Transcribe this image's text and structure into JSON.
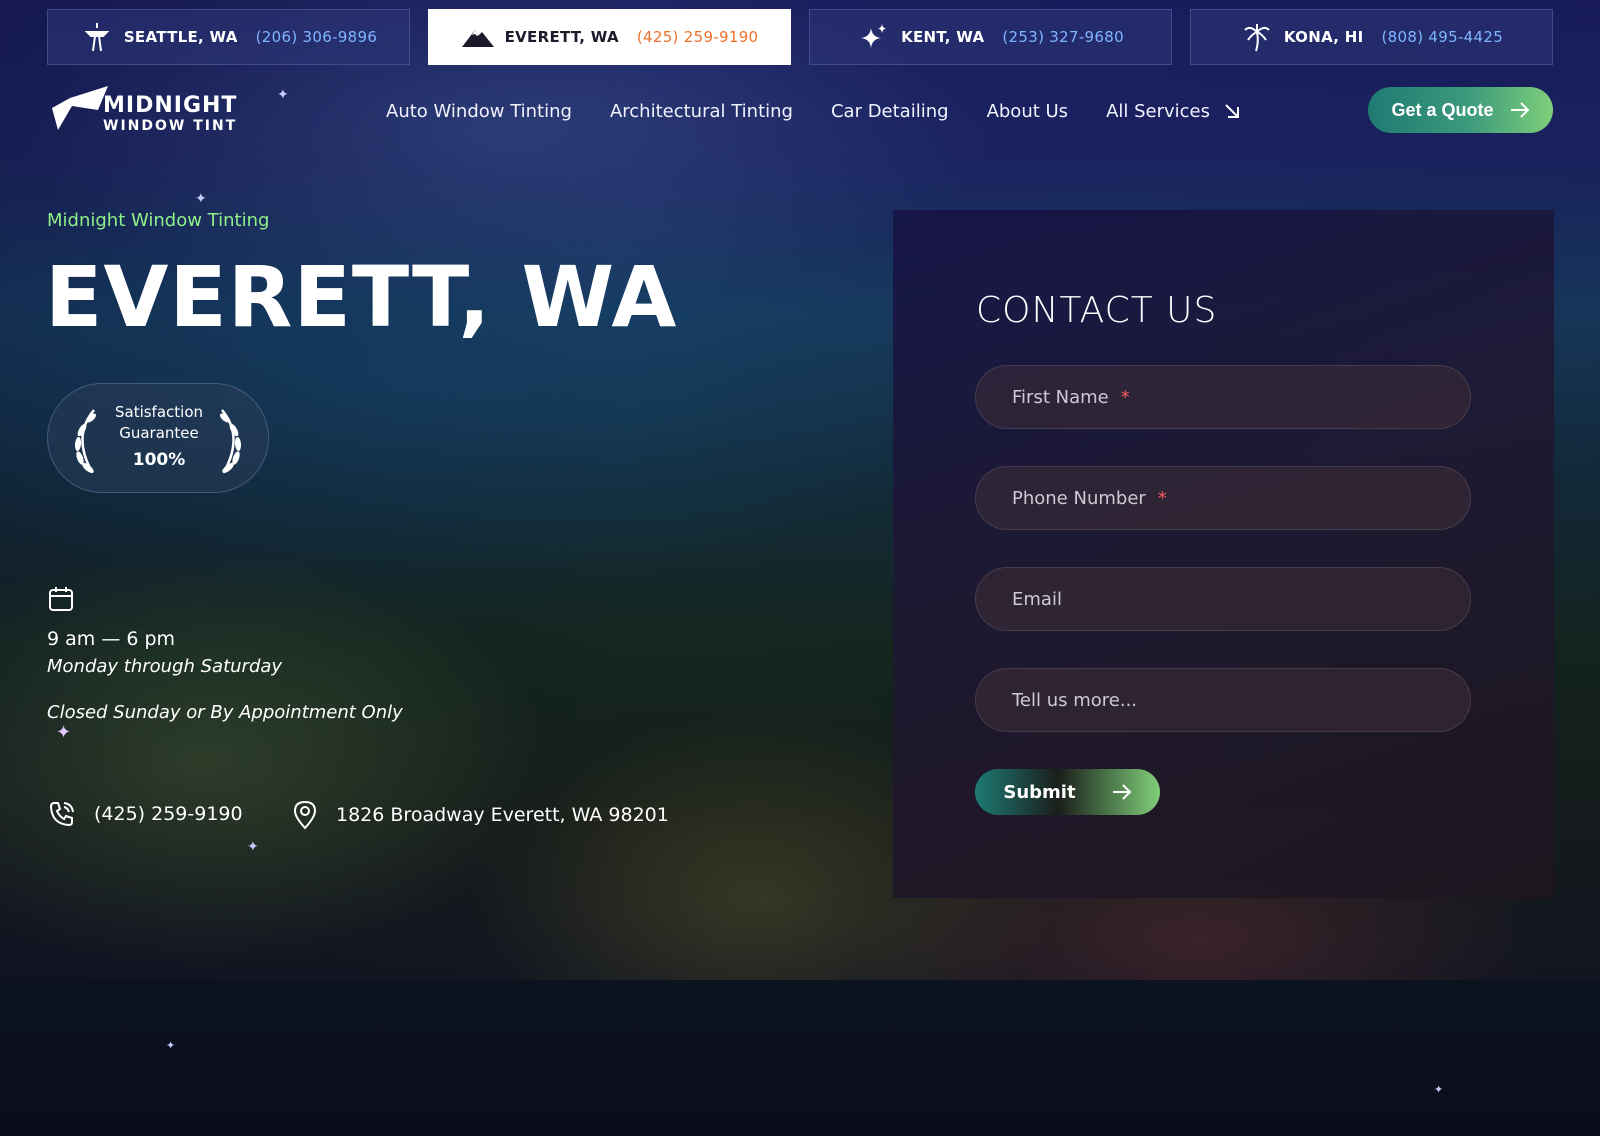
{
  "locations": [
    {
      "city": "SEATTLE, WA",
      "phone": "(206) 306-9896",
      "icon": "space-needle-icon",
      "active": false
    },
    {
      "city": "EVERETT, WA",
      "phone": "(425) 259-9190",
      "icon": "mountain-icon",
      "active": true
    },
    {
      "city": "KENT, WA",
      "phone": "(253) 327-9680",
      "icon": "sparkle-icon",
      "active": false
    },
    {
      "city": "KONA, HI",
      "phone": "(808) 495-4425",
      "icon": "palm-tree-icon",
      "active": false
    }
  ],
  "logo": {
    "line1": "MIDNIGHT",
    "line2": "WINDOW TINT"
  },
  "nav": {
    "items": [
      "Auto Window Tinting",
      "Architectural Tinting",
      "Car Detailing",
      "About Us",
      "All Services"
    ],
    "quote_label": "Get a Quote"
  },
  "hero": {
    "eyebrow": "Midnight Window Tinting",
    "title": "EVERETT, WA",
    "badge": {
      "line1": "Satisfaction",
      "line2": "Guarantee",
      "line3": "100%"
    },
    "hours": "9 am — 6 pm",
    "days": "Monday through Saturday",
    "closed": "Closed Sunday or By Appointment Only",
    "phone": "(425) 259-9190",
    "address": "1826 Broadway Everett, WA 98201"
  },
  "form": {
    "title": "CONTACT US",
    "first_name": "First Name",
    "phone": "Phone Number",
    "email": "Email",
    "message": "Tell us more...",
    "required_mark": "*",
    "submit": "Submit"
  },
  "colors": {
    "accent_orange": "#f0702a",
    "accent_green": "#8ff08a",
    "link_blue": "#7fb5ff"
  }
}
